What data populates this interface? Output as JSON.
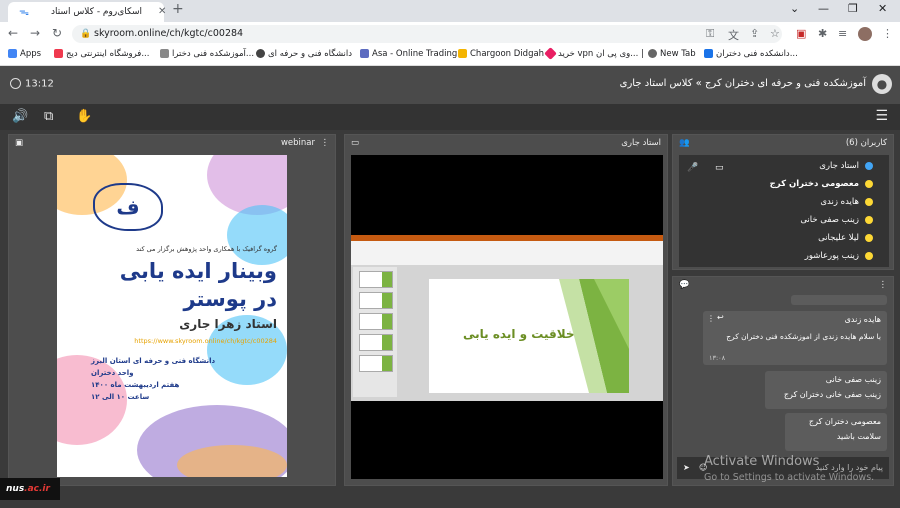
{
  "browser": {
    "tab_title": "اسکای‌روم - کلاس استاد جاری",
    "new_tab": "+",
    "url": "skyroom.online/ch/kgtc/c00284",
    "bookmarks": [
      {
        "label": "Apps",
        "color": "#4285f4"
      },
      {
        "label": "فروشگاه اینترنتی دیج...",
        "color": "#ef394e"
      },
      {
        "label": "آموزشکده فنی دخترا...",
        "color": "#888888"
      },
      {
        "label": "دانشگاه فنی و حرفه ای",
        "color": "#444444"
      },
      {
        "label": "Asa - Online Trading",
        "color": "#5c6bc0"
      },
      {
        "label": "Chargoon Didgah",
        "color": "#f4b400"
      },
      {
        "label": "خرید vpn وی پی ان... |",
        "color": "#e91e63"
      },
      {
        "label": "New Tab",
        "color": "#666666"
      },
      {
        "label": "دانشکده فنی دختران...",
        "color": "#1a73e8"
      }
    ]
  },
  "header": {
    "time": "13:12",
    "title": "آموزشکده فنی و حرفه ای دختران کرج » کلاس استاد جاری"
  },
  "panels": {
    "webinar": {
      "title": "webinar",
      "poster": {
        "intro": "گروه گرافیک با همکاری واحد پژوهش برگزار می کند",
        "title_line1": "وبینار ایده یابی",
        "title_line2": "در پوستر",
        "presenter": "استاد زهرا جاری",
        "link": "https://www.skyroom.online/ch/kgtc/c00284",
        "org_line1": "دانشگاه فنی و حرفه ای استان البرز",
        "org_line2": "واحد دختران",
        "date": "هفتم اردیبهشت ماه ۱۴۰۰",
        "time": "ساعت ۱۰ الی ۱۲"
      }
    },
    "screen": {
      "title": "استاد جاری",
      "slide_title": "خلاقیت و ایده یابی"
    },
    "users": {
      "title": "کاربران (6)",
      "list": [
        {
          "name": "استاد جاری",
          "color": "#42a5f5",
          "bold": false
        },
        {
          "name": "معصومی دختران کرج",
          "color": "#fdd835",
          "bold": true
        },
        {
          "name": "هایده زندی",
          "color": "#fdd835",
          "bold": false
        },
        {
          "name": "زینب صفی خانی",
          "color": "#fdd835",
          "bold": false
        },
        {
          "name": "لیلا علیجانی",
          "color": "#fdd835",
          "bold": false
        },
        {
          "name": "زینب پورعاشور",
          "color": "#fdd835",
          "bold": false
        }
      ]
    },
    "chat": {
      "messages": [
        {
          "sender": "هایده زندی",
          "text": "با سلام هایده زندی از اموزشکده فنی دختران کرج",
          "time": "۱۳:۰۸"
        },
        {
          "sender": "زینب صفی خانی",
          "text": "زینب صفی خانی دختران کرج"
        },
        {
          "sender": "معصومی دختران کرج",
          "text": "سلامت باشید"
        }
      ],
      "input_placeholder": "پیام خود را وارد کنید"
    }
  },
  "watermark": {
    "line1": "Activate Windows",
    "line2": "Go to Settings to activate Windows."
  },
  "logo": {
    "main": "nus",
    "suffix": ".ac.ir"
  }
}
